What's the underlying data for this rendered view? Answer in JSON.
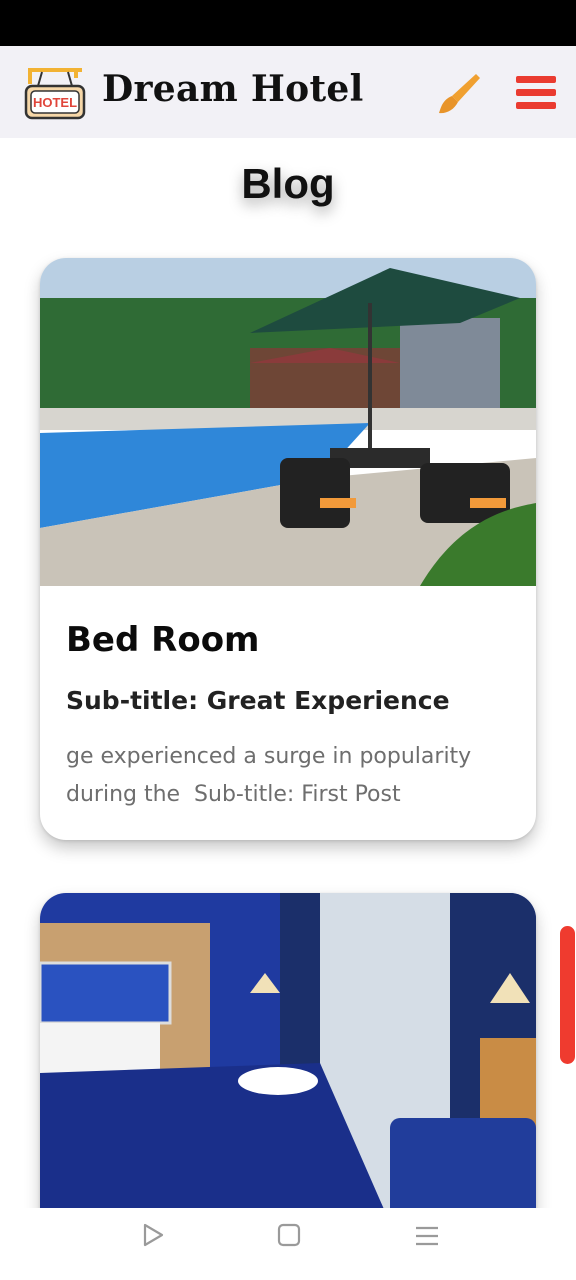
{
  "app": {
    "brand_title": "Dream Hotel",
    "logo_text": "HOTEL"
  },
  "icons": {
    "logo": "hotel-sign-icon",
    "theme": "paint-brush-icon",
    "menu": "hamburger-menu-icon",
    "nav_back": "triangle-back-icon",
    "nav_home": "square-home-icon",
    "nav_recent": "lines-recent-icon"
  },
  "colors": {
    "accent": "#ea3b30",
    "header_bg": "#f2f1f6",
    "brush": "#f0a030"
  },
  "page": {
    "section_title": "Blog"
  },
  "posts": [
    {
      "title": "Bed Room",
      "subtitle": "Sub-title: Great Experience",
      "excerpt": "ge experienced a surge in popularity during the  Sub-title: First Post",
      "image": "hotel-pool-with-umbrella-photo"
    },
    {
      "image": "hotel-bedroom-photo"
    }
  ]
}
